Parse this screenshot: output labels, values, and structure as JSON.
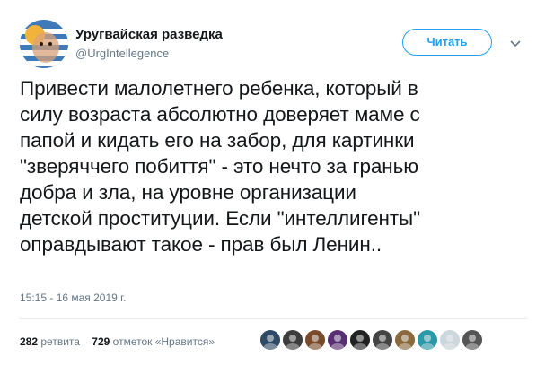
{
  "header": {
    "display_name": "Уругвайская разведка",
    "handle": "@UrgIntellegence",
    "follow_label": "Читать",
    "caret_icon": "chevron-down-icon"
  },
  "tweet": {
    "text": "Привести малолетнего ребенка, который в\nсилу возраста абсолютно доверяет маме с\nпапой и кидать его на забор, для картинки\n\"зверяччего побиття\" - это нечто за гранью\nдобра и зла, на уровне организации\nдетской проституции. Если \"интеллигенты\"\nоправдывают такое - прав был Ленин..",
    "timestamp": "15:15 - 16 мая 2019 г."
  },
  "stats": {
    "retweets_count": "282",
    "retweets_label": "ретвита",
    "likes_count": "729",
    "likes_label": "отметок «Нравится»"
  },
  "likers": [
    {
      "icon": "liker-avatar-1",
      "color": "#2f4a66"
    },
    {
      "icon": "liker-avatar-2",
      "color": "#3d3d3d"
    },
    {
      "icon": "liker-avatar-3",
      "color": "#7a4b2a"
    },
    {
      "icon": "liker-avatar-4",
      "color": "#5a2e73"
    },
    {
      "icon": "liker-avatar-5",
      "color": "#222222"
    },
    {
      "icon": "liker-avatar-6",
      "color": "#444444"
    },
    {
      "icon": "liker-avatar-7",
      "color": "#8a6a3c"
    },
    {
      "icon": "liker-avatar-8",
      "color": "#2b9aa8"
    },
    {
      "icon": "liker-avatar-9",
      "color": "#ccd6dd"
    },
    {
      "icon": "liker-avatar-10",
      "color": "#555555"
    }
  ],
  "colors": {
    "accent": "#1da1f2",
    "text": "#14171a",
    "secondary": "#657786",
    "divider": "#e6ecf0"
  }
}
